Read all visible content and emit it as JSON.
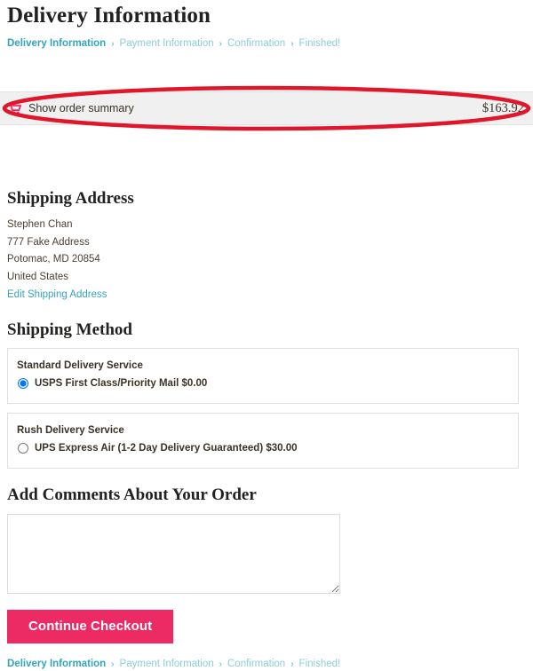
{
  "page": {
    "title": "Delivery Information"
  },
  "steps": {
    "separator": "›",
    "items": [
      {
        "label": "Delivery Information",
        "active": true
      },
      {
        "label": "Payment Information",
        "active": false
      },
      {
        "label": "Confirmation",
        "active": false
      },
      {
        "label": "Finished!",
        "active": false
      }
    ]
  },
  "order_summary": {
    "icon": "shopping-cart-icon",
    "label": "Show order summary",
    "total": "$163.92",
    "background_color": "#f0f0f0"
  },
  "shipping_address": {
    "heading": "Shipping Address",
    "lines": [
      "Stephen Chan",
      "777 Fake Address",
      "Potomac, MD 20854",
      "United States"
    ],
    "edit_link": "Edit Shipping Address"
  },
  "shipping_method": {
    "heading": "Shipping Method",
    "groups": [
      {
        "name": "Standard Delivery Service",
        "options": [
          {
            "label": "USPS First Class/Priority Mail $0.00",
            "selected": true
          }
        ]
      },
      {
        "name": "Rush Delivery Service",
        "options": [
          {
            "label": "UPS Express Air (1-2 Day Delivery Guaranteed) $30.00",
            "selected": false
          }
        ]
      }
    ]
  },
  "comments": {
    "heading": "Add Comments About Your Order",
    "value": "",
    "placeholder": ""
  },
  "actions": {
    "continue_label": "Continue Checkout",
    "continue_color": "#ec2a63"
  },
  "annotation": {
    "shape": "ellipse",
    "color": "#e0162b",
    "target": "show-order-summary-bar"
  },
  "colors": {
    "accent_teal": "#33a5ba",
    "muted_teal": "#8dcdd8",
    "text_dark": "#3a3226",
    "heading_dark": "#23211f"
  }
}
